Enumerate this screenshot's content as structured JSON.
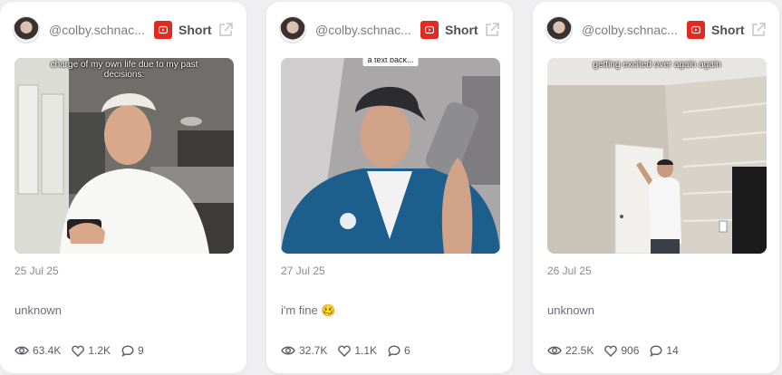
{
  "cards": [
    {
      "handle": "@colby.schnac...",
      "badge": "Short",
      "caption": "charge of my own life due to my past decisions:",
      "date": "25 Jul 25",
      "description": "unknown",
      "views": "63.4K",
      "likes": "1.2K",
      "comments": "9"
    },
    {
      "handle": "@colby.schnac...",
      "badge": "Short",
      "caption": "a text back...",
      "date": "27 Jul 25",
      "description": "i'm fine 🥴",
      "views": "32.7K",
      "likes": "1.1K",
      "comments": "6"
    },
    {
      "handle": "@colby.schnac...",
      "badge": "Short",
      "caption": "getting excited over again again",
      "date": "26 Jul 25",
      "description": "unknown",
      "views": "22.5K",
      "likes": "906",
      "comments": "14"
    }
  ],
  "icons": {
    "badge": "youtube-icon",
    "external": "external-link-icon",
    "views": "eye-icon",
    "likes": "heart-icon",
    "comments": "comment-icon"
  },
  "colors": {
    "badge_red": "#e32a20",
    "background": "#efeff2",
    "card": "#ffffff"
  }
}
